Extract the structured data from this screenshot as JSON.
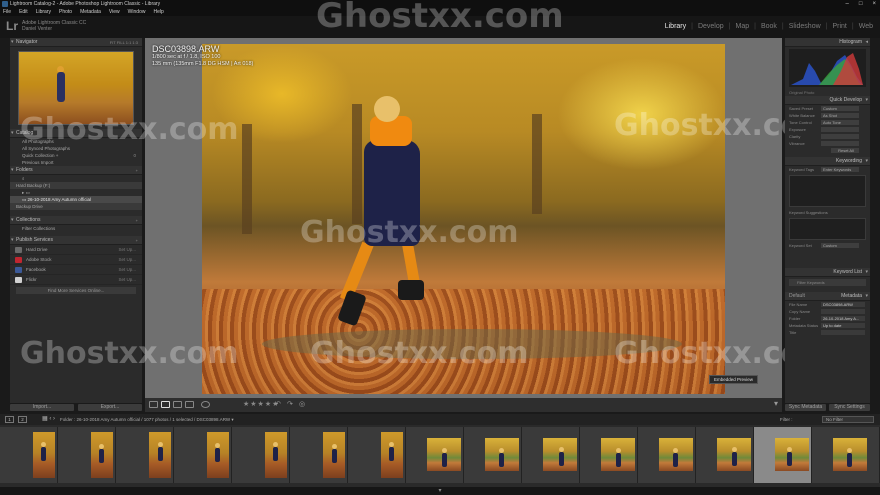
{
  "window": {
    "title": "Lightroom Catalog-2 - Adobe Photoshop Lightroom Classic - Library",
    "controls": [
      "–",
      "□",
      "×"
    ]
  },
  "menu": [
    "File",
    "Edit",
    "Library",
    "Photo",
    "Metadata",
    "View",
    "Window",
    "Help"
  ],
  "identity": {
    "logo": "Lr",
    "product": "Adobe Lightroom Classic CC",
    "user": "Daniel Venter"
  },
  "modules": [
    "Library",
    "Develop",
    "Map",
    "Book",
    "Slideshow",
    "Print",
    "Web"
  ],
  "active_module": "Library",
  "watermark": "Ghostxx.com",
  "left_panel": {
    "navigator": {
      "title": "Navigator",
      "zoom_options": "FIT  FILL  1:1  1:3"
    },
    "catalog": {
      "title": "Catalog",
      "items": [
        {
          "label": "All Photographs",
          "count": ""
        },
        {
          "label": "All Synced Photographs",
          "count": ""
        },
        {
          "label": "Quick Collection +",
          "count": "0"
        },
        {
          "label": "Previous Import",
          "count": ""
        }
      ]
    },
    "folders": {
      "title": "Folders",
      "search_placeholder": "",
      "volume": {
        "label": "Hard Backup (F:)",
        "count": ""
      },
      "tree": [
        {
          "label": "",
          "count": ""
        },
        {
          "label": "26-10-2018 Amy Autumn official",
          "count": ""
        }
      ],
      "volume2": {
        "label": "Backup Drive",
        "count": ""
      }
    },
    "collections": {
      "title": "Collections",
      "items": [
        {
          "label": "Filter Collections"
        }
      ]
    },
    "publish_services": {
      "title": "Publish Services",
      "items": [
        {
          "label": "Hard Drive",
          "action": "Set Up...",
          "color": "#6a6a6a"
        },
        {
          "label": "Adobe Stock",
          "action": "Set Up...",
          "color": "#c02630"
        },
        {
          "label": "Facebook",
          "action": "Set Up...",
          "color": "#3b5998"
        },
        {
          "label": "Flickr",
          "action": "Set Up...",
          "color": "#d1d1d1"
        }
      ],
      "find_more": "Find More Services Online..."
    },
    "import_button": "Import...",
    "export_button": "Export..."
  },
  "photo": {
    "filename": "DSC03898.ARW",
    "exposure_line": "1/800 sec at f / 1.8, ISO 100",
    "lens_line": "135 mm (135mm F1.8 DG HSM | Art 018)",
    "embedded_preview_label": "Embedded Preview"
  },
  "toolbar": {
    "stars": "★★★★★"
  },
  "right_panel": {
    "histogram": {
      "title": "Histogram",
      "label": "Original Photo"
    },
    "quick_develop": {
      "title": "Quick Develop",
      "rows": [
        {
          "label": "Saved Preset",
          "value": "Custom"
        },
        {
          "label": "White Balance",
          "value": "As Shot"
        },
        {
          "label": "Tone Control",
          "value": "Auto Tone"
        },
        {
          "label": "Exposure",
          "value": ""
        },
        {
          "label": "Clarity",
          "value": ""
        },
        {
          "label": "Vibrance",
          "value": ""
        }
      ],
      "reset": "Reset All"
    },
    "keywording": {
      "title": "Keywording",
      "tags_label": "Keyword Tags",
      "tags_value": "Enter Keywords",
      "suggestions_label": "Keyword Suggestions",
      "set_label": "Keyword Set",
      "set_value": "Custom",
      "set_items": [
        "",
        ""
      ]
    },
    "keyword_list": {
      "title": "Keyword List",
      "filter_placeholder": "Filter Keywords"
    },
    "metadata": {
      "title": "Metadata",
      "preset_label": "Default",
      "fields": [
        {
          "label": "File Name",
          "value": "DSC03898.ARW"
        },
        {
          "label": "Copy Name",
          "value": ""
        },
        {
          "label": "Folder",
          "value": "26-10-2018 Amy A..."
        },
        {
          "label": "Metadata Status",
          "value": "Up to date"
        },
        {
          "label": "Title",
          "value": ""
        }
      ]
    },
    "sync_metadata_button": "Sync Metadata",
    "sync_settings_button": "Sync Settings"
  },
  "filmstrip_bar": {
    "screen1": "1",
    "screen2": "2",
    "path": "Folder : 26-10-2018 Amy Autumn official  /  1077 photos / 1 selected / DSC03898.ARW  ▾",
    "filter_label": "Filter :",
    "filter_value": "No Filter"
  }
}
